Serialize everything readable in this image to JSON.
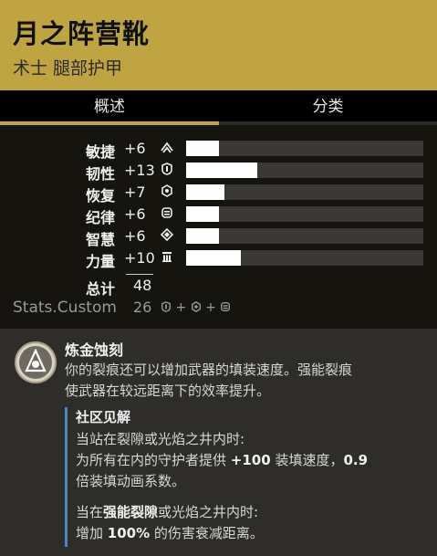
{
  "item": {
    "title": "月之阵营靴",
    "subtitle": "术士 腿部护甲"
  },
  "tabs": [
    "概述",
    "分类"
  ],
  "stats": [
    {
      "label": "敏捷",
      "value": "+6",
      "icon": "mobility-icon",
      "fill": 0.14
    },
    {
      "label": "韧性",
      "value": "+13",
      "icon": "resilience-icon",
      "fill": 0.3
    },
    {
      "label": "恢复",
      "value": "+7",
      "icon": "recovery-icon",
      "fill": 0.16
    },
    {
      "label": "纪律",
      "value": "+6",
      "icon": "discipline-icon",
      "fill": 0.14
    },
    {
      "label": "智慧",
      "value": "+6",
      "icon": "intellect-icon",
      "fill": 0.14
    },
    {
      "label": "力量",
      "value": "+10",
      "icon": "strength-icon",
      "fill": 0.23
    }
  ],
  "total": {
    "label": "总计",
    "value": "48"
  },
  "custom": {
    "label": "Stats.Custom",
    "value": "26"
  },
  "perk": {
    "title": "炼金蚀刻",
    "desc_line1": "你的裂痕还可以增加武器的填装速度。强能裂痕",
    "desc_line2": "使武器在较远距离下的效率提升。",
    "insight_title": "社区见解",
    "line1": "当站在裂隙或光焰之井内时:",
    "line2_pre": "为所有在内的守护者提供 ",
    "line2_b1": "+100",
    "line2_mid": " 装填速度，",
    "line2_b2": "0.9",
    "line3": "倍装填动画系数。",
    "line4_pre": "当在",
    "line4_b": "强能裂隙",
    "line4_post": "或光焰之井内时:",
    "line5_pre": "增加 ",
    "line5_b": "100%",
    "line5_post": " 的伤害衰减距离。"
  }
}
